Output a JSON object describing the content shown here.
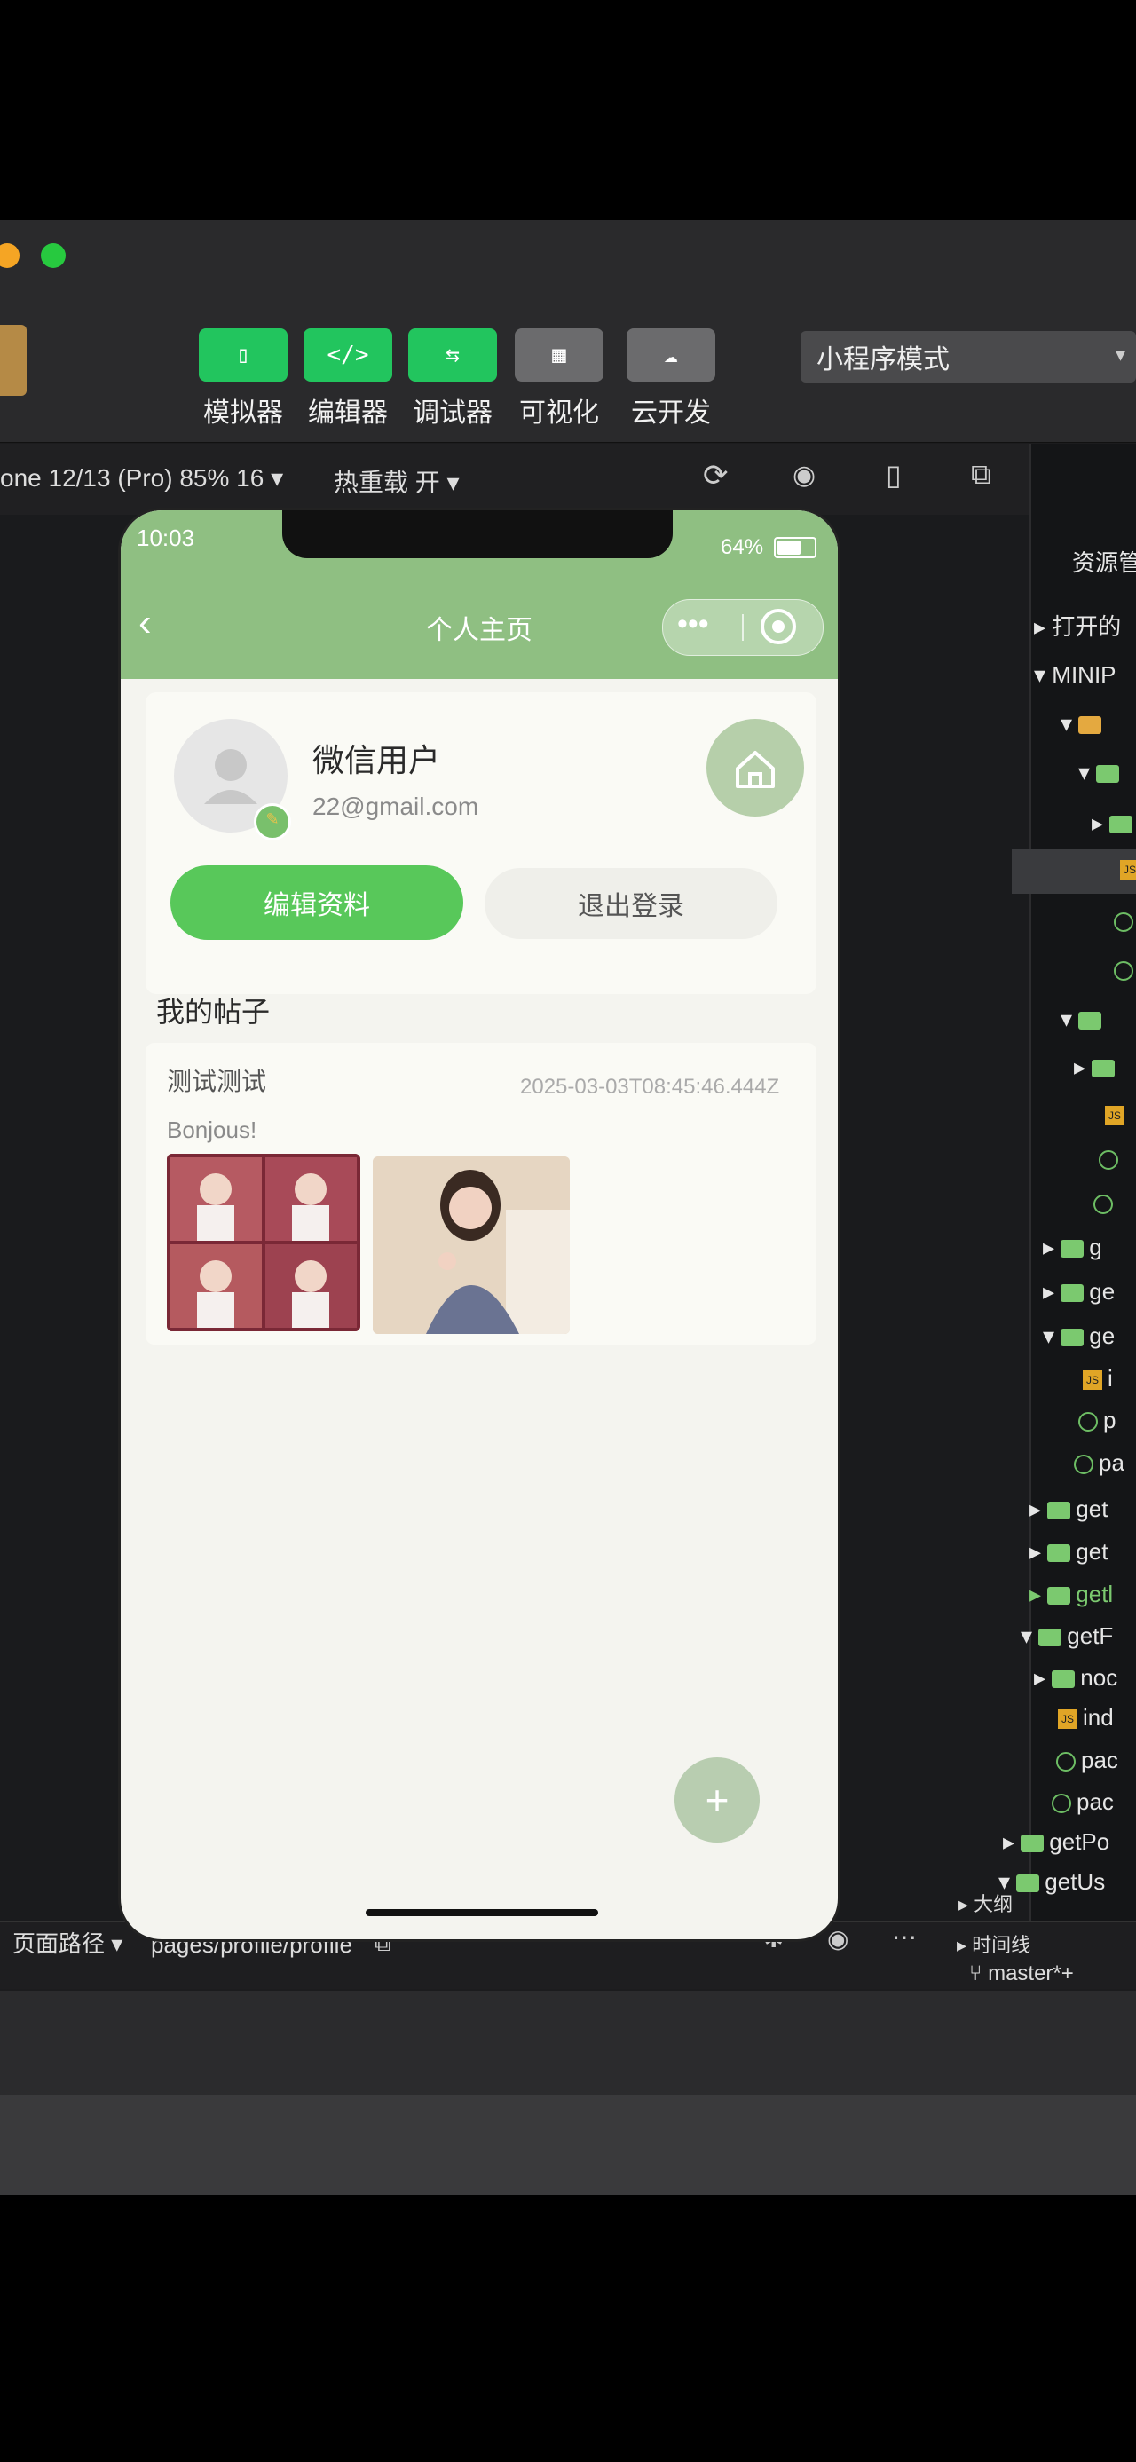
{
  "toolbar": {
    "buttons": [
      {
        "label": "模拟器",
        "icon": "phone-icon"
      },
      {
        "label": "编辑器",
        "icon": "code-icon"
      },
      {
        "label": "调试器",
        "icon": "sliders-icon"
      },
      {
        "label": "可视化",
        "icon": "layout-icon"
      },
      {
        "label": "云开发",
        "icon": "cloud-icon"
      }
    ],
    "mode": "小程序模式"
  },
  "subbar": {
    "device": "one 12/13 (Pro) 85% 16 ▾",
    "hot_reload": "热重载 开 ▾"
  },
  "phone": {
    "time": "10:03",
    "battery": "64%",
    "battery_level": 0.64,
    "nav_title": "个人主页",
    "profile": {
      "username": "微信用户",
      "email": "22@gmail.com",
      "edit_label": "编辑资料",
      "logout_label": "退出登录"
    },
    "section_title": "我的帖子",
    "post": {
      "title": "测试测试",
      "date": "2025-03-03T08:45:46.444Z",
      "text": "Bonjous!"
    },
    "fab": "+"
  },
  "statusbar": {
    "path_label": "页面路径 ▾",
    "path": "pages/profile/profile",
    "branch": "master*+"
  },
  "explorer": {
    "header": "资源管",
    "open": "打开的",
    "root": "MINIP",
    "items": [
      "g",
      "ge",
      "ge",
      "i",
      "p",
      "pa",
      "get",
      "get",
      "getl",
      "getF",
      "noc",
      "ind",
      "pac",
      "pac",
      "getPo",
      "getUs"
    ],
    "outline": "大纲",
    "timeline": "时间线"
  },
  "colors": {
    "accent": "#22c55e",
    "nav_green": "#8fbf82",
    "edit_button": "#58c85a"
  }
}
